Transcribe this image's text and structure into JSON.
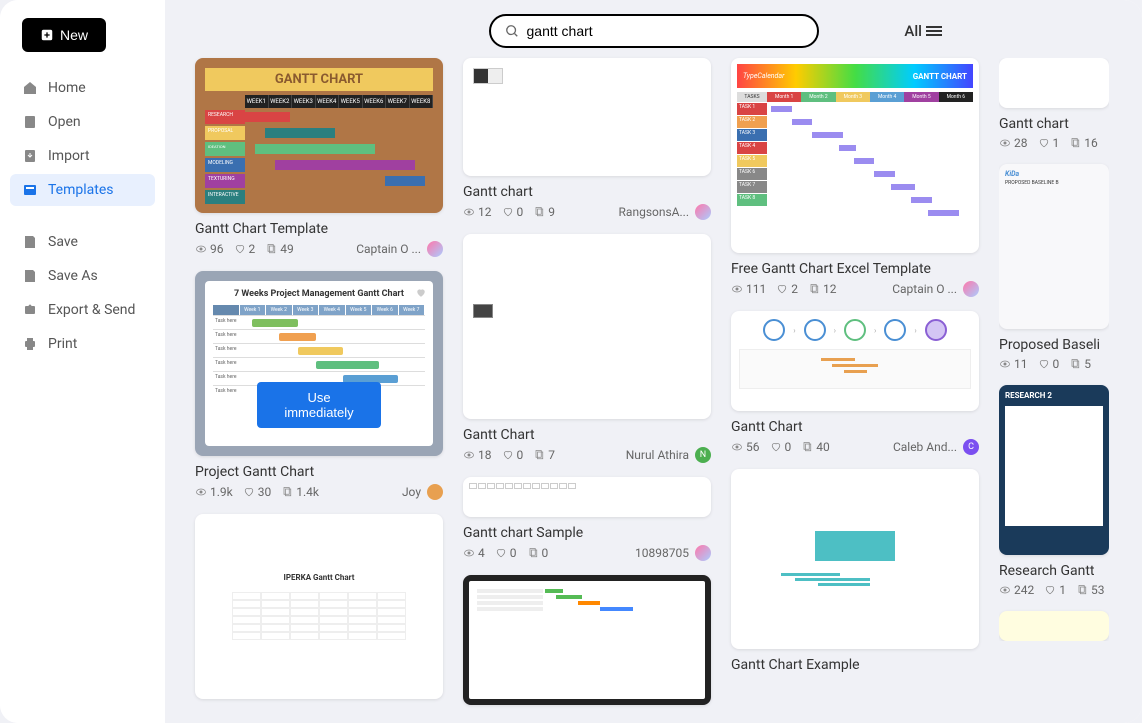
{
  "new_button": "New",
  "nav": {
    "home": "Home",
    "open": "Open",
    "import": "Import",
    "templates": "Templates",
    "save": "Save",
    "save_as": "Save As",
    "export": "Export & Send",
    "print": "Print"
  },
  "search": {
    "value": "gantt chart"
  },
  "filter_label": "All",
  "use_immediately": "Use immediately",
  "cards": {
    "c1": {
      "title": "Gantt Chart Template",
      "views": "96",
      "likes": "2",
      "copies": "49",
      "author": "Captain O ..."
    },
    "c2": {
      "title": "Project Gantt Chart",
      "views": "1.9k",
      "likes": "30",
      "copies": "1.4k",
      "author": "Joy"
    },
    "c3": {
      "title": "Gantt chart",
      "views": "12",
      "likes": "0",
      "copies": "9",
      "author": "RangsonsA..."
    },
    "c4": {
      "title": "Gantt Chart",
      "views": "18",
      "likes": "0",
      "copies": "7",
      "author": "Nurul Athira"
    },
    "c5": {
      "title": "Gantt chart Sample",
      "views": "4",
      "likes": "0",
      "copies": "0",
      "author": "10898705"
    },
    "c6": {
      "title": "Free Gantt Chart Excel Template",
      "views": "111",
      "likes": "2",
      "copies": "12",
      "author": "Captain O ..."
    },
    "c7": {
      "title": "Gantt Chart",
      "views": "56",
      "likes": "0",
      "copies": "40",
      "author": "Caleb And..."
    },
    "c8": {
      "title": "Gantt Chart Example"
    },
    "c9": {
      "title": "Gantt chart",
      "views": "28",
      "likes": "1",
      "copies": "16"
    },
    "c10": {
      "title": "Proposed Baseli",
      "views": "11",
      "likes": "0",
      "copies": "5"
    },
    "c11": {
      "title": "Research Gantt",
      "views": "242",
      "likes": "1",
      "copies": "53"
    }
  },
  "thumb_text": {
    "gantt_chart_upper": "GANTT CHART",
    "seven_weeks": "7 Weeks Project Management Gantt Chart",
    "typecalendar": "TypeCalendar",
    "iperka": "IPERKA Gantt Chart",
    "research2": "RESEARCH 2"
  }
}
